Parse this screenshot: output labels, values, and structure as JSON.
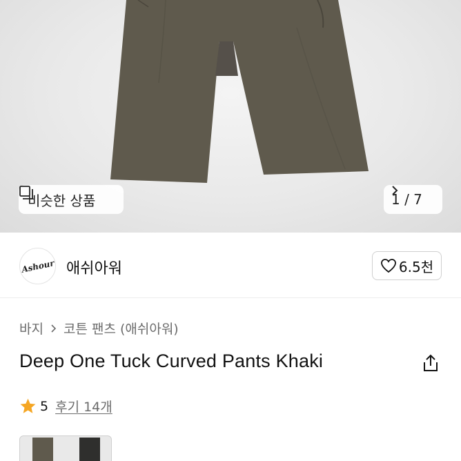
{
  "gallery": {
    "similar_label": "비슷한 상품",
    "current": "1",
    "total": "7",
    "counter_text": "1 / 7",
    "product_color": "#5f5a4d"
  },
  "brand": {
    "logo_text": "Ashour",
    "name": "애쉬아워",
    "like_count": "6.5천"
  },
  "breadcrumb": {
    "level1": "바지",
    "level2": "코튼 팬츠 (애쉬아워)"
  },
  "product": {
    "title": "Deep One Tuck Curved Pants Khaki"
  },
  "rating": {
    "score": "5",
    "review_label": "후기 14개",
    "star_color": "#f5a623"
  },
  "swatches": [
    {
      "color": "#5f5a4d"
    },
    {
      "color": "#2f2f2d"
    }
  ]
}
